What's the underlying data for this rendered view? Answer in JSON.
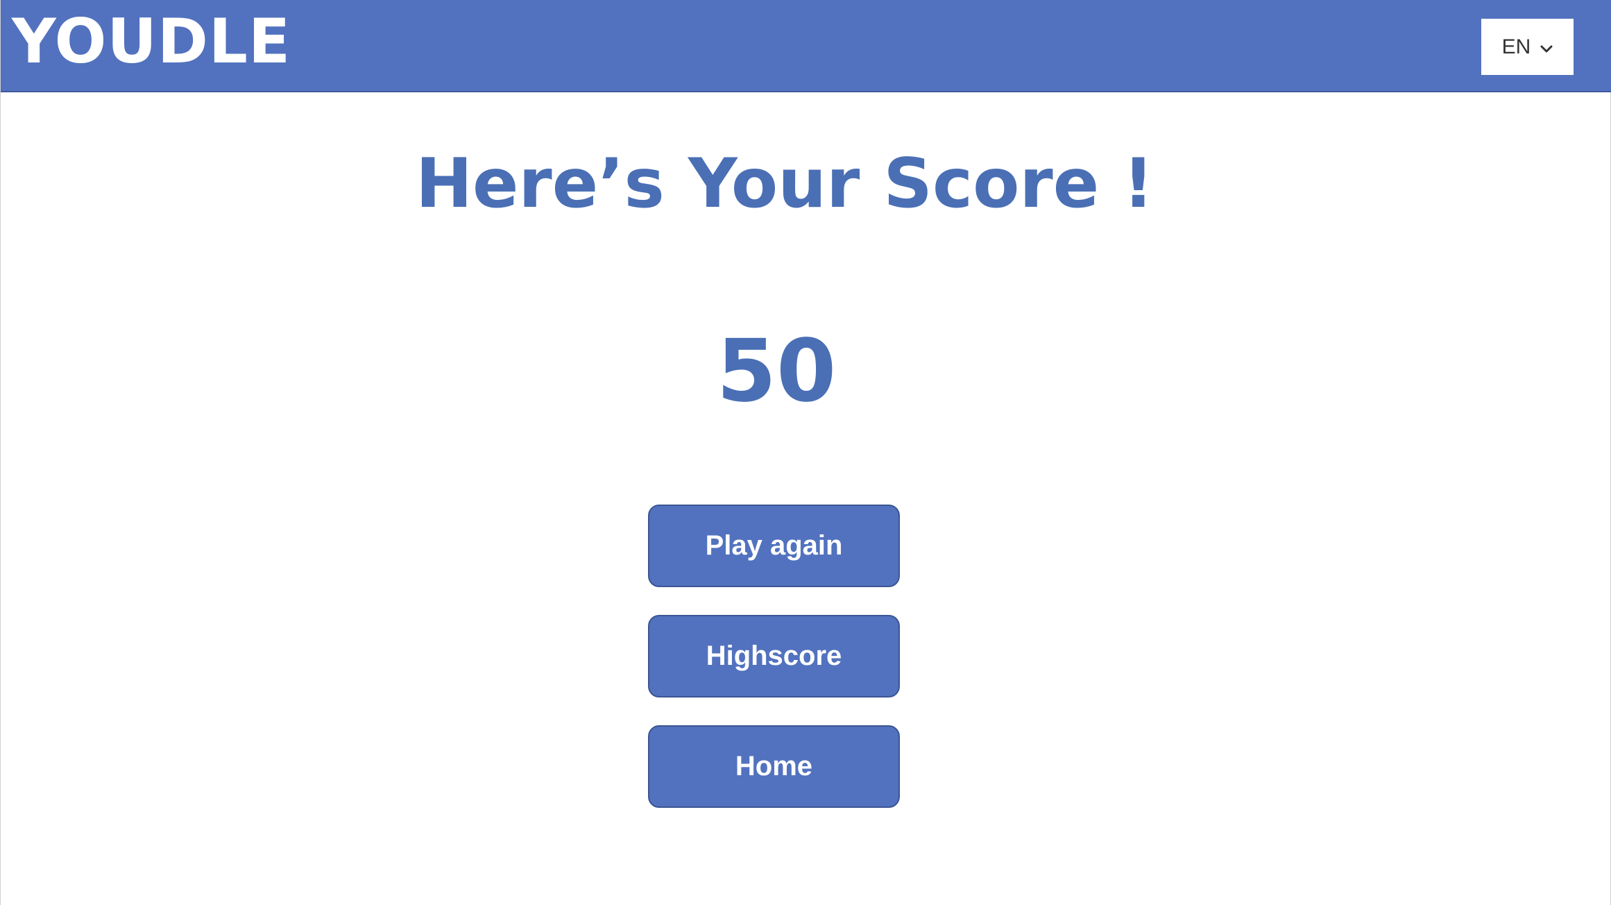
{
  "header": {
    "logo_text": "YOUDLE",
    "language": {
      "selected": "EN",
      "icon": "chevron-down-icon"
    }
  },
  "main": {
    "title": "Here’s Your Score !",
    "score": "50",
    "buttons": {
      "play_again": "Play again",
      "highscore": "Highscore",
      "home": "Home"
    }
  },
  "colors": {
    "header_bg": "#5272bf",
    "accent_text": "#4a6fb5",
    "button_bg": "#5272bf",
    "button_text": "#ffffff"
  }
}
